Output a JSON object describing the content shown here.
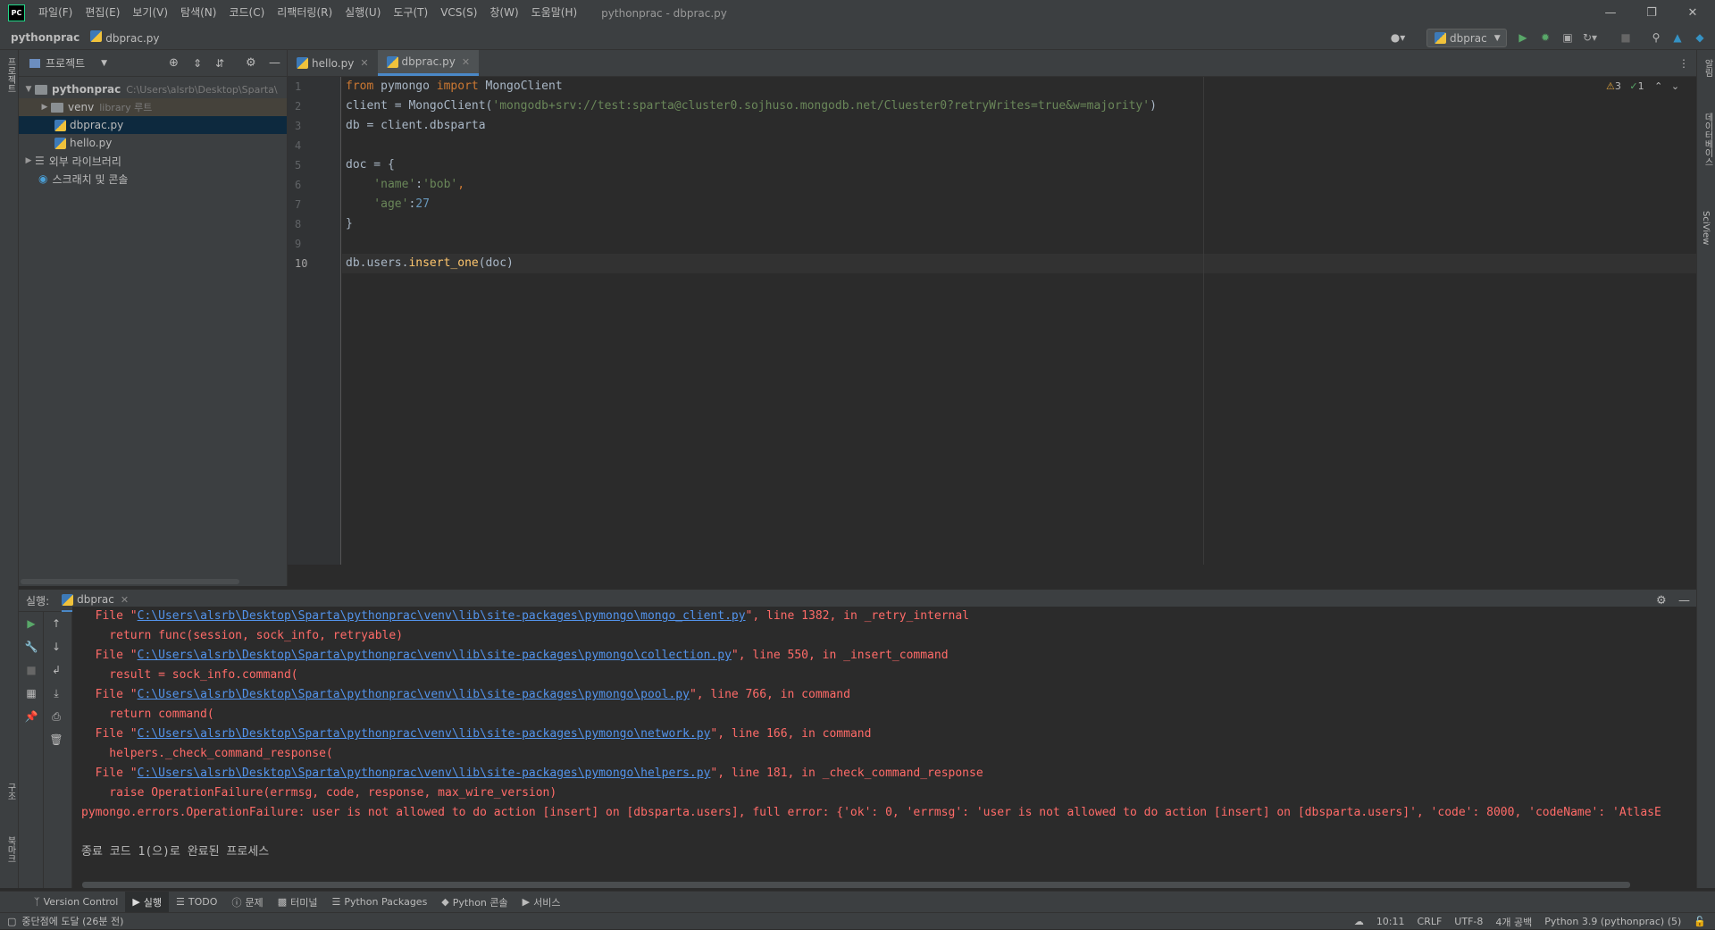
{
  "titlebar": {
    "menu": [
      "파일(F)",
      "편집(E)",
      "보기(V)",
      "탐색(N)",
      "코드(C)",
      "리팩터링(R)",
      "실행(U)",
      "도구(T)",
      "VCS(S)",
      "창(W)",
      "도움말(H)"
    ],
    "title": "pythonprac - dbprac.py"
  },
  "navbar": {
    "project": "pythonprac",
    "file": "dbprac.py",
    "run_config": "dbprac"
  },
  "left_strip": {
    "project_label": "프로젝트",
    "structure_label": "구조",
    "bookmarks_label": "북마크"
  },
  "right_strip": {
    "notifications_label": "알림",
    "database_label": "데이터베이스",
    "sciview_label": "SciView"
  },
  "project_panel": {
    "header": "프로젝트",
    "root_name": "pythonprac",
    "root_path": "C:\\Users\\alsrb\\Desktop\\Sparta\\",
    "venv": "venv",
    "venv_note": "library 루트",
    "files": [
      "dbprac.py",
      "hello.py"
    ],
    "external_libs": "외부 라이브러리",
    "scratches": "스크래치 및 콘솔"
  },
  "editor": {
    "tabs": [
      {
        "label": "hello.py"
      },
      {
        "label": "dbprac.py"
      }
    ],
    "line_numbers": [
      "1",
      "2",
      "3",
      "4",
      "5",
      "6",
      "7",
      "8",
      "9",
      "10"
    ],
    "current_line": 10,
    "inspections": {
      "warnings": "3",
      "ok": "1"
    },
    "code": {
      "l1_from": "from",
      "l1_mod": " pymongo ",
      "l1_import": "import",
      "l1_cls": " MongoClient",
      "l2_pre": "client = MongoClient(",
      "l2_str": "'mongodb+srv://test:sparta@cluster0.sojhuso.mongodb.net/Cluester0?retryWrites=true&w=majority'",
      "l2_post": ")",
      "l3": "db = client.dbsparta",
      "l5": "doc = {",
      "l6_key": "    'name'",
      "l6_colon": ":",
      "l6_val": "'bob'",
      "l6_comma": ",",
      "l7_key": "    'age'",
      "l7_colon": ":",
      "l7_val": "27",
      "l8": "}",
      "l10_pre": "db.users.",
      "l10_fn": "insert_one",
      "l10_post": "(doc)"
    }
  },
  "run_panel": {
    "label": "실행:",
    "tab": "dbprac",
    "output": [
      {
        "pre": "  File \"",
        "link": "C:\\Users\\alsrb\\Desktop\\Sparta\\pythonprac\\venv\\lib\\site-packages\\pymongo\\mongo_client.py",
        "post": "\", line 1382, in _retry_internal"
      },
      {
        "pre": "    return func(session, sock_info, retryable)",
        "link": "",
        "post": ""
      },
      {
        "pre": "  File \"",
        "link": "C:\\Users\\alsrb\\Desktop\\Sparta\\pythonprac\\venv\\lib\\site-packages\\pymongo\\collection.py",
        "post": "\", line 550, in _insert_command"
      },
      {
        "pre": "    result = sock_info.command(",
        "link": "",
        "post": ""
      },
      {
        "pre": "  File \"",
        "link": "C:\\Users\\alsrb\\Desktop\\Sparta\\pythonprac\\venv\\lib\\site-packages\\pymongo\\pool.py",
        "post": "\", line 766, in command"
      },
      {
        "pre": "    return command(",
        "link": "",
        "post": ""
      },
      {
        "pre": "  File \"",
        "link": "C:\\Users\\alsrb\\Desktop\\Sparta\\pythonprac\\venv\\lib\\site-packages\\pymongo\\network.py",
        "post": "\", line 166, in command"
      },
      {
        "pre": "    helpers._check_command_response(",
        "link": "",
        "post": ""
      },
      {
        "pre": "  File \"",
        "link": "C:\\Users\\alsrb\\Desktop\\Sparta\\pythonprac\\venv\\lib\\site-packages\\pymongo\\helpers.py",
        "post": "\", line 181, in _check_command_response"
      },
      {
        "pre": "    raise OperationFailure(errmsg, code, response, max_wire_version)",
        "link": "",
        "post": ""
      },
      {
        "pre": "pymongo.errors.OperationFailure: user is not allowed to do action [insert] on [dbsparta.users], full error: {'ok': 0, 'errmsg': 'user is not allowed to do action [insert] on [dbsparta.users]', 'code': 8000, 'codeName': 'AtlasE",
        "link": "",
        "post": ""
      }
    ],
    "exit_message": "종료 코드 1(으)로 완료된 프로세스"
  },
  "bottom_tabs": [
    "Version Control",
    "실행",
    "TODO",
    "문제",
    "터미널",
    "Python Packages",
    "Python 콘솔",
    "서비스"
  ],
  "statusbar": {
    "message": "중단점에 도달 (26분 전)",
    "position": "10:11",
    "line_sep": "CRLF",
    "encoding": "UTF-8",
    "indent": "4개 공백",
    "interpreter": "Python 3.9 (pythonprac) (5)"
  }
}
